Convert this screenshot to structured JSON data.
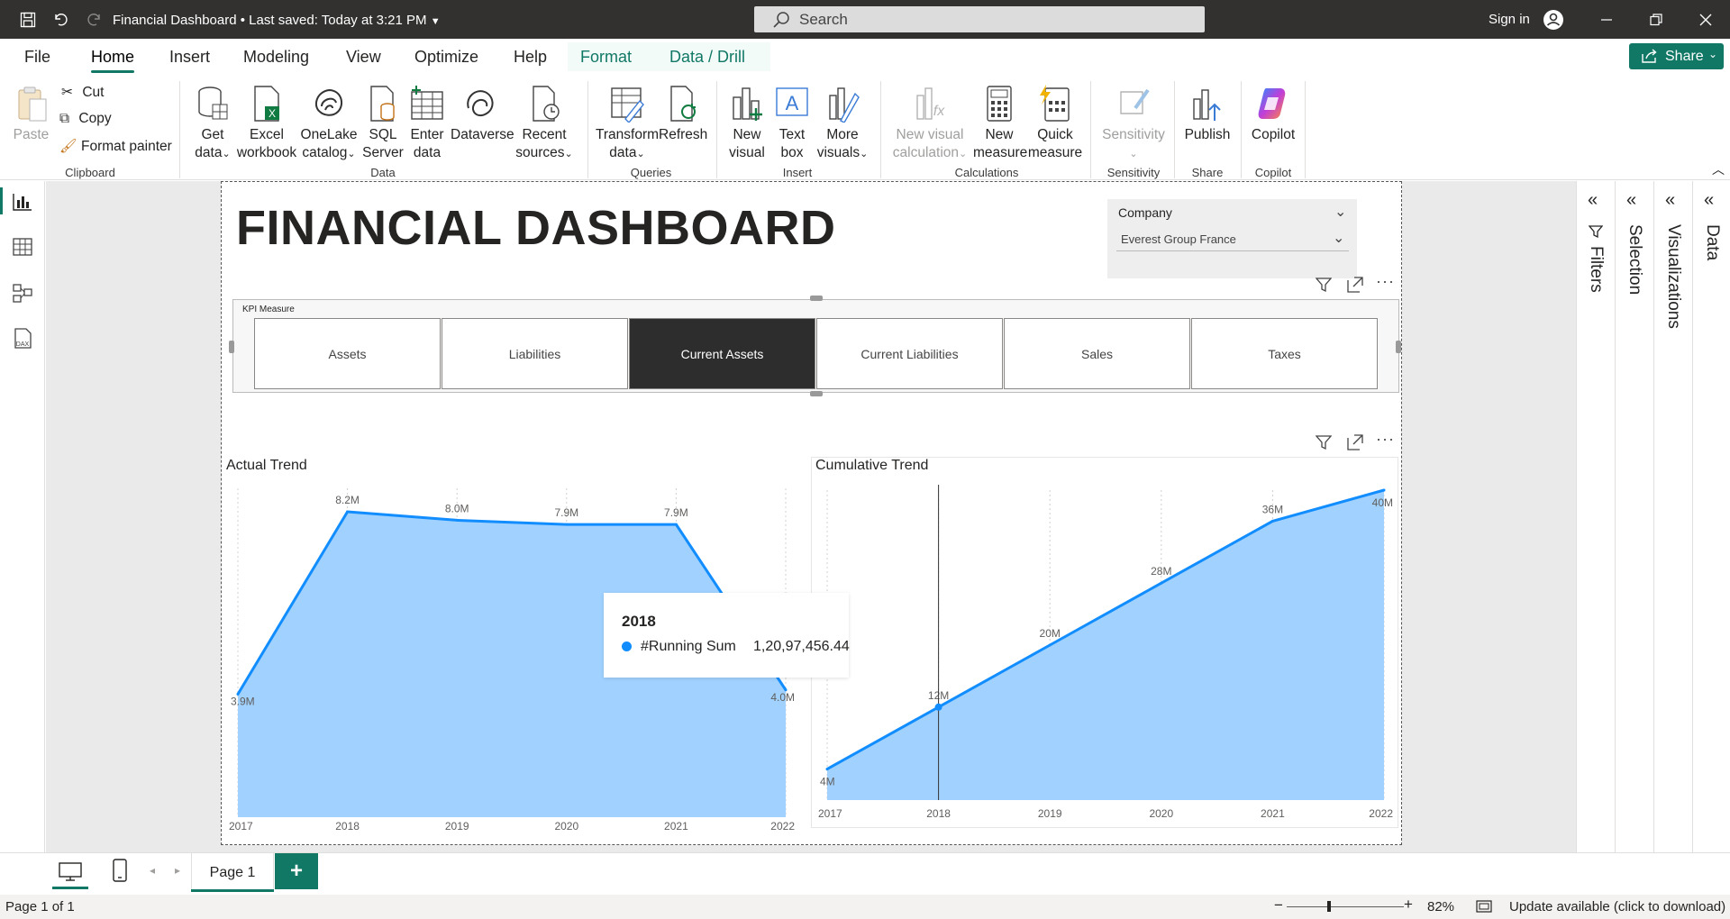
{
  "titlebar": {
    "title": "Financial Dashboard",
    "saved": "• Last saved: Today at 3:21 PM",
    "search_placeholder": "Search",
    "sign_in": "Sign in"
  },
  "menu": {
    "tabs": [
      "File",
      "Home",
      "Insert",
      "Modeling",
      "View",
      "Optimize",
      "Help",
      "Format",
      "Data / Drill"
    ],
    "active": "Home",
    "share": "Share"
  },
  "ribbon": {
    "clipboard": {
      "paste": "Paste",
      "cut": "Cut",
      "copy": "Copy",
      "format_painter": "Format painter",
      "group": "Clipboard"
    },
    "data": {
      "get_data": [
        "Get",
        "data"
      ],
      "excel": [
        "Excel",
        "workbook"
      ],
      "onelake": [
        "OneLake",
        "catalog"
      ],
      "sql": [
        "SQL",
        "Server"
      ],
      "enter": [
        "Enter",
        "data"
      ],
      "dataverse": "Dataverse",
      "recent": [
        "Recent",
        "sources"
      ],
      "group": "Data"
    },
    "queries": {
      "transform": [
        "Transform",
        "data"
      ],
      "refresh": "Refresh",
      "group": "Queries"
    },
    "insert": {
      "new_visual": [
        "New",
        "visual"
      ],
      "text_box": [
        "Text",
        "box"
      ],
      "more_visuals": [
        "More",
        "visuals"
      ],
      "group": "Insert"
    },
    "calculations": {
      "new_visual_calc": [
        "New visual",
        "calculation"
      ],
      "new_measure": [
        "New",
        "measure"
      ],
      "quick_measure": [
        "Quick",
        "measure"
      ],
      "group": "Calculations"
    },
    "sensitivity": {
      "label": "Sensitivity",
      "group": "Sensitivity"
    },
    "share": {
      "publish": "Publish",
      "group": "Share"
    },
    "copilot": {
      "label": "Copilot",
      "group": "Copilot"
    }
  },
  "report": {
    "title": "FINANCIAL DASHBOARD",
    "slicer": {
      "label": "Company",
      "value": "Everest Group France"
    },
    "kpi": {
      "label": "KPI Measure",
      "buttons": [
        "Assets",
        "Liabilities",
        "Current Assets",
        "Current Liabilities",
        "Sales",
        "Taxes"
      ],
      "selected": "Current Assets"
    },
    "tooltip": {
      "title": "2018",
      "series": "#Running Sum",
      "value": "1,20,97,456.44"
    }
  },
  "chart_data": [
    {
      "type": "area",
      "title": "Actual Trend",
      "x": [
        "2017",
        "2018",
        "2019",
        "2020",
        "2021",
        "2022"
      ],
      "values": [
        3.9,
        8.2,
        8.0,
        7.9,
        7.9,
        4.0
      ],
      "data_labels": [
        "3.9M",
        "8.2M",
        "8.0M",
        "7.9M",
        "7.9M",
        "4.0M"
      ],
      "unit": "M",
      "color": "#118DFF",
      "fill": "#A0D1FF",
      "grid": false
    },
    {
      "type": "area",
      "title": "Cumulative Trend",
      "x": [
        "2017",
        "2018",
        "2019",
        "2020",
        "2021",
        "2022"
      ],
      "values": [
        4,
        12,
        20,
        28,
        36,
        40
      ],
      "data_labels": [
        "4M",
        "12M",
        "20M",
        "28M",
        "36M",
        "40M"
      ],
      "unit": "M",
      "color": "#118DFF",
      "fill": "#A0D1FF",
      "grid": false,
      "highlighted": "2018"
    }
  ],
  "panes": [
    "Filters",
    "Selection",
    "Visualizations",
    "Data"
  ],
  "bottom": {
    "page_tab": "Page 1",
    "add_page": "+"
  },
  "status": {
    "page": "Page 1 of 1",
    "zoom": "82%",
    "update": "Update available (click to download)"
  },
  "colors": {
    "brand": "#117865",
    "series": "#118DFF",
    "area": "#A0D1FF",
    "titlebar": "#323130"
  }
}
